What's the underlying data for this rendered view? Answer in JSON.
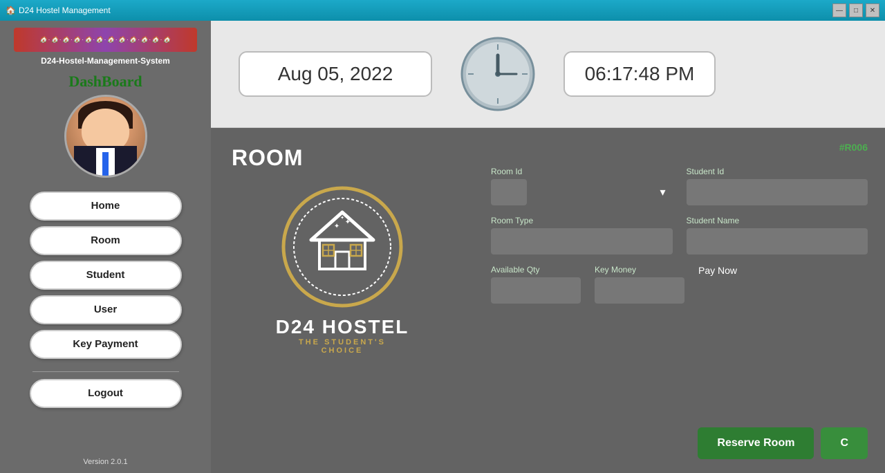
{
  "window": {
    "title": "D24 Hostel Management",
    "icon": "🏠",
    "controls": {
      "minimize": "—",
      "maximize": "□",
      "close": "✕"
    }
  },
  "sidebar": {
    "app_name": "D24-Hostel-Management-System",
    "dashboard_label": "DashBoard",
    "version": "Version 2.0.1",
    "banner_text": "🏠·🏠·🏠·🏠·🏠·🏠·🏠·🏠·🏠·🏠·🏠·🏠",
    "nav_items": [
      {
        "id": "home",
        "label": "Home"
      },
      {
        "id": "room",
        "label": "Room"
      },
      {
        "id": "student",
        "label": "Student"
      },
      {
        "id": "user",
        "label": "User"
      },
      {
        "id": "key-payment",
        "label": "Key Payment"
      }
    ],
    "logout_label": "Logout"
  },
  "topbar": {
    "date": "Aug 05, 2022",
    "time": "06:17:48 PM",
    "clock_icon": "🕐"
  },
  "room_panel": {
    "heading": "ROOM",
    "badge": "#R006",
    "logo": {
      "main": "D24 HOSTEL",
      "sub1": "THE STUDENT'S",
      "sub2": "CHOICE"
    },
    "form": {
      "room_id_label": "Room Id",
      "room_id_value": "",
      "room_id_placeholder": "",
      "student_id_label": "Student Id",
      "student_id_value": "",
      "room_type_label": "Room Type",
      "room_type_value": "",
      "student_name_label": "Student Name",
      "student_name_value": "",
      "available_qty_label": "Available Qty",
      "available_qty_value": "",
      "key_money_label": "Key Money",
      "key_money_value": "",
      "pay_now_label": "Pay Now"
    },
    "buttons": {
      "reserve_label": "Reserve Room",
      "cancel_label": "C"
    }
  }
}
